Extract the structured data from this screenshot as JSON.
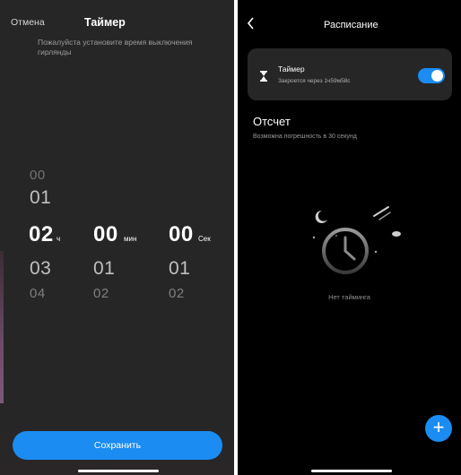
{
  "timer_screen": {
    "cancel_label": "Отмена",
    "title": "Таймер",
    "hint": "Пожалуйста установите время выключения гирлянды",
    "hours": {
      "above2": "00",
      "above1": "01",
      "selected": "02",
      "below1": "03",
      "below2": "04",
      "unit": "ч"
    },
    "minutes": {
      "selected": "00",
      "below1": "01",
      "below2": "02",
      "unit": "мин"
    },
    "seconds": {
      "selected": "00",
      "below1": "01",
      "below2": "02",
      "unit": "Сек"
    },
    "save_label": "Сохранить"
  },
  "schedule_screen": {
    "title": "Расписание",
    "timer_card": {
      "name": "Таймер",
      "subtitle": "Закроется через 1ч59м58с",
      "enabled": true
    },
    "countdown": {
      "title": "Отсчет",
      "subtitle": "Возможна погрешность в 30 секунд"
    },
    "empty_text": "Нет тайминга"
  },
  "colors": {
    "accent": "#1a8cf2",
    "left_bg": "#262626",
    "right_bg": "#000000",
    "card_bg": "#262626"
  },
  "icons": [
    "chevron-left-icon",
    "hourglass-icon",
    "alarm-clock-icon",
    "plus-icon"
  ]
}
